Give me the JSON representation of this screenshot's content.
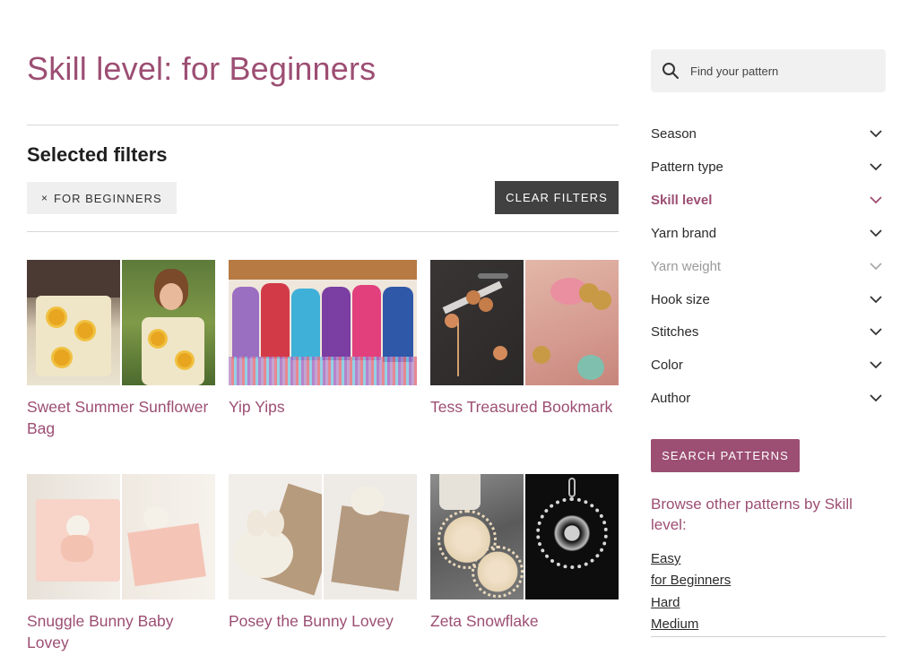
{
  "page": {
    "title": "Skill level: for Beginners"
  },
  "filters": {
    "heading": "Selected filters",
    "chips": [
      {
        "x": "×",
        "label": "FOR BEGINNERS"
      }
    ],
    "clear_label": "CLEAR FILTERS"
  },
  "patterns": [
    {
      "title": "Sweet Summer Sunflower Bag"
    },
    {
      "title": "Yip Yips"
    },
    {
      "title": "Tess Treasured Bookmark"
    },
    {
      "title": "Snuggle Bunny Baby Lovey"
    },
    {
      "title": "Posey the Bunny Lovey"
    },
    {
      "title": "Zeta Snowflake"
    }
  ],
  "sidebar": {
    "search": {
      "placeholder": "Find your pattern",
      "icon": "search-icon"
    },
    "facets": [
      {
        "label": "Season",
        "state": "normal"
      },
      {
        "label": "Pattern type",
        "state": "normal"
      },
      {
        "label": "Skill level",
        "state": "active"
      },
      {
        "label": "Yarn brand",
        "state": "normal"
      },
      {
        "label": "Yarn weight",
        "state": "muted"
      },
      {
        "label": "Hook size",
        "state": "normal"
      },
      {
        "label": "Stitches",
        "state": "normal"
      },
      {
        "label": "Color",
        "state": "normal"
      },
      {
        "label": "Author",
        "state": "normal"
      }
    ],
    "search_button": "SEARCH PATTERNS",
    "browse_title": "Browse other patterns by Skill level:",
    "browse_links": [
      "Easy",
      "for Beginners",
      "Hard",
      "Medium"
    ]
  },
  "colors": {
    "accent": "#9c4e73",
    "dark_button": "#414141",
    "muted": "#9a9a9a"
  }
}
